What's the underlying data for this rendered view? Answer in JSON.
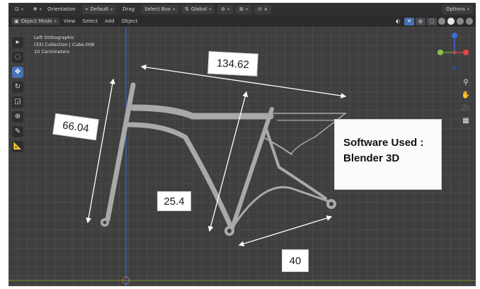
{
  "header": {
    "orientation_label": "Orientation",
    "orientation_value": "Default",
    "drag_label": "Drag",
    "drag_value": "Select Box",
    "transform_value": "Global",
    "options_label": "Options"
  },
  "menubar": {
    "mode": "Object Mode",
    "items": [
      "View",
      "Select",
      "Add",
      "Object"
    ]
  },
  "viewport_info": {
    "view": "Left Orthographic",
    "collection": "(33) Collection | Cube.008",
    "scale": "10 Centimeters"
  },
  "annotations": {
    "dim_top": "134.62",
    "dim_left": "66.04",
    "dim_mid": "25.4",
    "dim_bottom": "40",
    "note_line1": "Software Used :",
    "note_line2": "Blender 3D"
  },
  "colors": {
    "viewport": "#3f3f3f",
    "grid": "#4a4a4a",
    "frame_tube": "#a9a9a9",
    "axis_blue": "#3a6fd8",
    "axis_green": "#6e9a2c",
    "active_tool": "#4772b3"
  },
  "icons": {
    "toolbar": [
      "cursor-icon",
      "select-circle-icon",
      "move-icon",
      "rotate-icon",
      "scale-icon",
      "transform-icon",
      "annotate-icon",
      "measure-icon"
    ],
    "nav": [
      "zoom-icon",
      "hand-icon",
      "camera-icon",
      "grid-icon"
    ]
  }
}
